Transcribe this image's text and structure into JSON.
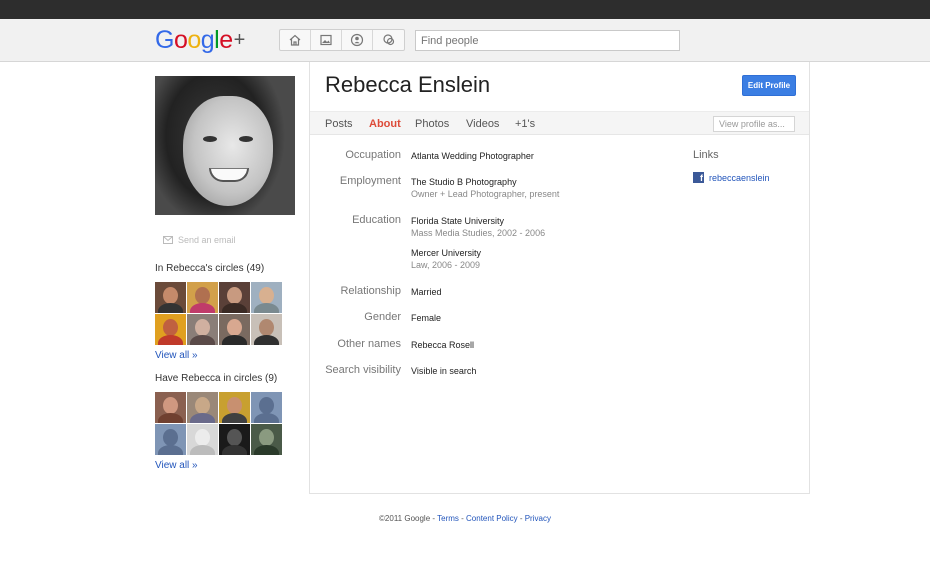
{
  "header": {
    "logo": {
      "letters": [
        {
          "ch": "G",
          "color": "#3369e8"
        },
        {
          "ch": "o",
          "color": "#d50f25"
        },
        {
          "ch": "o",
          "color": "#eeb211"
        },
        {
          "ch": "g",
          "color": "#3369e8"
        },
        {
          "ch": "l",
          "color": "#009925"
        },
        {
          "ch": "e",
          "color": "#d50f25"
        }
      ],
      "plus": "+"
    },
    "nav_icons": [
      "home-icon",
      "photos-icon",
      "profile-icon",
      "circles-icon"
    ],
    "search_placeholder": "Find people"
  },
  "profile": {
    "name": "Rebecca Enslein",
    "edit_button": "Edit Profile",
    "send_email": "Send an email"
  },
  "tabs": [
    {
      "label": "Posts",
      "active": false
    },
    {
      "label": "About",
      "active": true
    },
    {
      "label": "Photos",
      "active": false
    },
    {
      "label": "Videos",
      "active": false
    },
    {
      "label": "+1's",
      "active": false
    }
  ],
  "view_profile_as": "View profile as...",
  "about": {
    "occupation": {
      "label": "Occupation",
      "value": "Atlanta Wedding Photographer"
    },
    "employment": {
      "label": "Employment",
      "value": "The Studio B Photography",
      "sub": "Owner + Lead Photographer, present"
    },
    "education": {
      "label": "Education",
      "schools": [
        {
          "name": "Florida State University",
          "sub": "Mass Media Studies, 2002 - 2006"
        },
        {
          "name": "Mercer University",
          "sub": "Law, 2006 - 2009"
        }
      ]
    },
    "relationship": {
      "label": "Relationship",
      "value": "Married"
    },
    "gender": {
      "label": "Gender",
      "value": "Female"
    },
    "other_names": {
      "label": "Other names",
      "value": "Rebecca Rosell"
    },
    "search_visibility": {
      "label": "Search visibility",
      "value": "Visible in search"
    }
  },
  "links": {
    "title": "Links",
    "items": [
      {
        "icon": "facebook-icon",
        "text": "rebeccaenslein"
      }
    ]
  },
  "circles": {
    "in_title": "In Rebecca's circles (49)",
    "have_title": "Have Rebecca in circles (9)",
    "view_all": "View all »"
  },
  "footer": {
    "copyright": "©2011 Google - ",
    "terms": "Terms",
    "sep1": " - ",
    "content_policy": "Content Policy",
    "sep2": " - ",
    "privacy": "Privacy"
  }
}
